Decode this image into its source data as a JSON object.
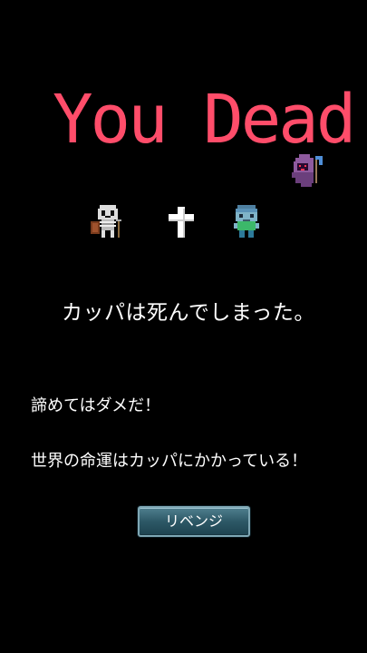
{
  "screen": {
    "title": "You Dead",
    "death_message": "カッパは死んでしまった。",
    "encourage_message": "諦めてはダメだ！",
    "fate_message": "世界の命運はカッパにかかっている！",
    "revenge_button_label": "リベンジ"
  },
  "sprites": {
    "reaper": "reaper-icon",
    "skeleton": "skeleton-icon",
    "cross": "cross-icon",
    "kappa": "kappa-icon"
  },
  "colors": {
    "background": "#000000",
    "title": "#ff4d6a",
    "text": "#ffffff",
    "button": "#2d5866"
  }
}
